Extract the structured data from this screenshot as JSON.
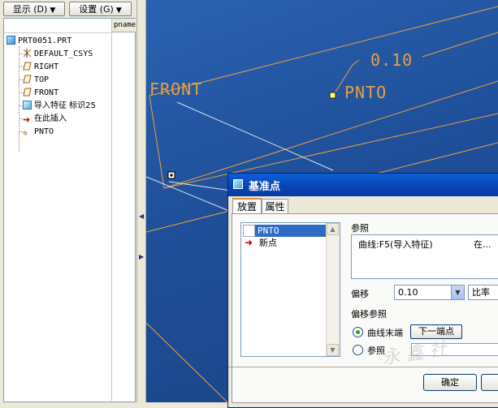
{
  "toolbar": {
    "show_label": "显示 (D)",
    "settings_label": "设置 (G)"
  },
  "tree": {
    "column_header": "pname",
    "items": [
      {
        "label": "PRT0051.PRT",
        "icon": "part-icon"
      },
      {
        "label": "DEFAULT_CSYS",
        "icon": "csys-icon"
      },
      {
        "label": "RIGHT",
        "icon": "datum-plane-icon"
      },
      {
        "label": "TOP",
        "icon": "datum-plane-icon"
      },
      {
        "label": "FRONT",
        "icon": "datum-plane-icon"
      },
      {
        "label": "导入特征 标识25",
        "icon": "import-feature-icon"
      },
      {
        "label": "在此插入",
        "icon": "insert-here-arrow-icon"
      },
      {
        "label": "PNTO",
        "icon": "datum-point-icon"
      }
    ]
  },
  "graphics": {
    "front_label": "FRONT",
    "point_label": "PNTO",
    "dimension_label": "0.10",
    "watermark": "永 鑫 社"
  },
  "dialog": {
    "title": "基准点",
    "tabs": [
      "放置",
      "属性"
    ],
    "points_list": [
      "PNTO",
      "新点"
    ],
    "reference_label": "参照",
    "reference_value": "曲线:F5(导入特征)",
    "reference_suffix": "在...",
    "offset_label": "偏移",
    "offset_value": "0.10",
    "offset_type": "比率",
    "offset_ref_label": "偏移参照",
    "curve_end_label": "曲线末端",
    "next_end_button": "下一端点",
    "ref_option_label": "参照",
    "ok_button": "确定"
  },
  "colors": {
    "cad_background": "#1f4f99",
    "cad_geometry": "#e8a040",
    "titlebar": "#0842b4",
    "selection": "#316ac5"
  }
}
